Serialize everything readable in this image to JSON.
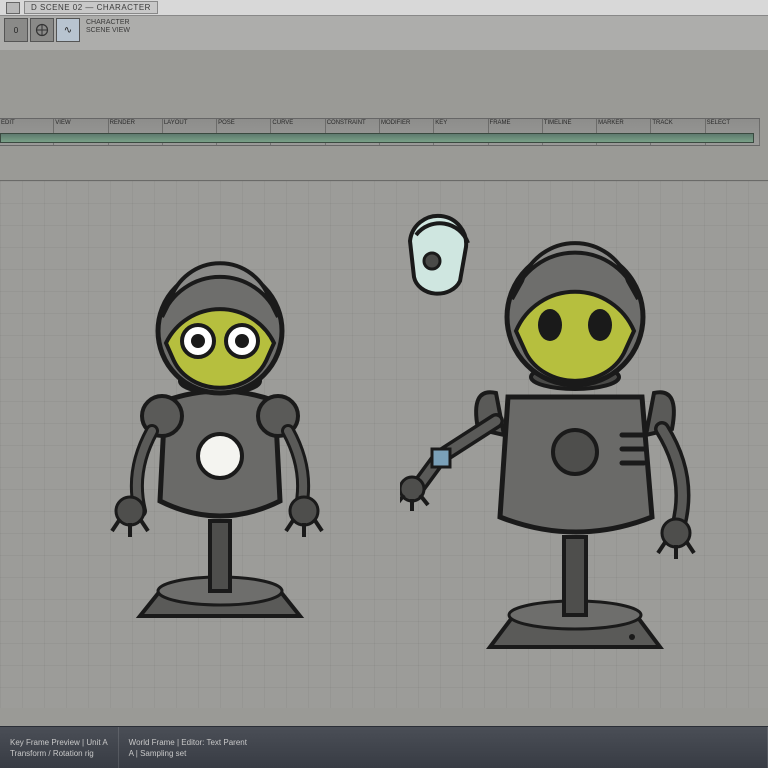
{
  "menubar": {
    "field_label": "D",
    "title": "SCENE 02 — CHARACTER"
  },
  "toolbar": {
    "btn_a": "0",
    "line1": "CHARACTER",
    "line2": "SCENE VIEW"
  },
  "ruler": {
    "cells": [
      "EDIT",
      "VIEW",
      "RENDER",
      "LAYOUT",
      "POSE",
      "CURVE",
      "CONSTRAINT",
      "MODIFIER",
      "KEY",
      "FRAME",
      "TIMELINE",
      "MARKER",
      "TRACK",
      "SELECT"
    ]
  },
  "status": {
    "left_line1": "Key Frame Preview | Unit A",
    "left_line2": "Transform / Rotation rig",
    "mid_line1": "World Frame  |  Editor: Text Parent",
    "mid_line2": "A | Sampling set"
  }
}
